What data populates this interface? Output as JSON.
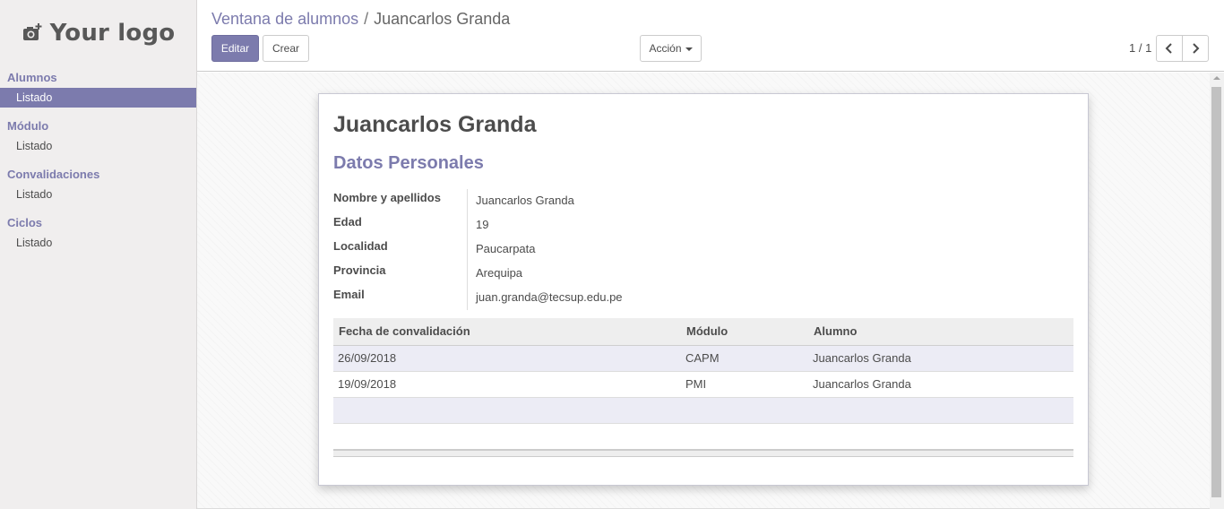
{
  "sidebar": {
    "logo_text": "Your logo",
    "sections": [
      {
        "title": "Alumnos",
        "item": "Listado"
      },
      {
        "title": "Módulo",
        "item": "Listado"
      },
      {
        "title": "Convalidaciones",
        "item": "Listado"
      },
      {
        "title": "Ciclos",
        "item": "Listado"
      }
    ]
  },
  "breadcrumb": {
    "parent": "Ventana de alumnos",
    "separator": "/",
    "current": "Juancarlos Granda"
  },
  "buttons": {
    "edit": "Editar",
    "create": "Crear",
    "action": "Acción"
  },
  "pager": {
    "value": "1 / 1"
  },
  "record": {
    "title": "Juancarlos Granda",
    "section": "Datos Personales",
    "fields": [
      {
        "label": "Nombre y apellidos",
        "value": "Juancarlos Granda"
      },
      {
        "label": "Edad",
        "value": "19"
      },
      {
        "label": "Localidad",
        "value": "Paucarpata"
      },
      {
        "label": "Provincia",
        "value": "Arequipa"
      },
      {
        "label": "Email",
        "value": "juan.granda@tecsup.edu.pe"
      }
    ]
  },
  "table": {
    "headers": [
      "Fecha de convalidación",
      "Módulo",
      "Alumno"
    ],
    "rows": [
      [
        "26/09/2018",
        "CAPM",
        "Juancarlos Granda"
      ],
      [
        "19/09/2018",
        "PMI",
        "Juancarlos Granda"
      ]
    ]
  },
  "colors": {
    "brand": "#7c7bad"
  }
}
